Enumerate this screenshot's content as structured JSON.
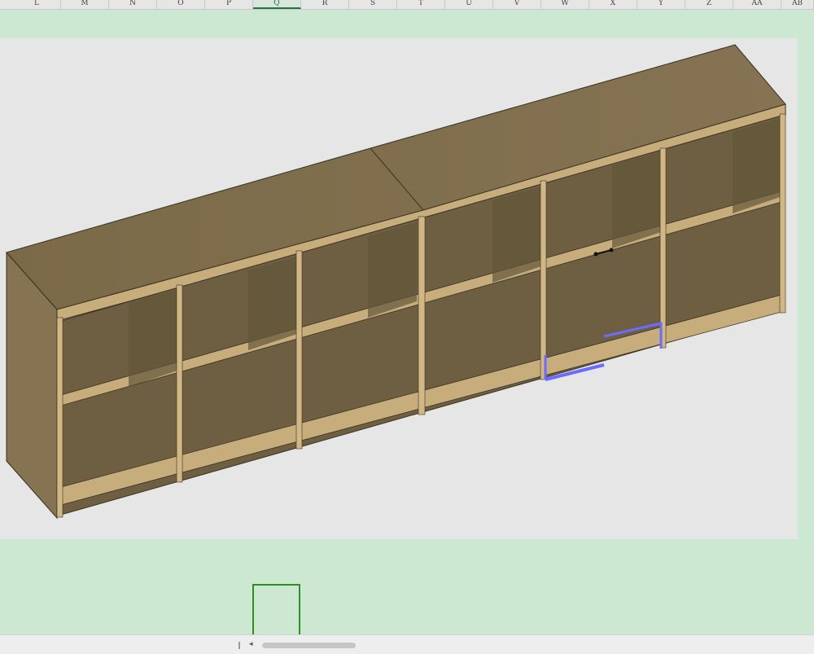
{
  "columns": [
    "L",
    "M",
    "N",
    "O",
    "P",
    "Q",
    "R",
    "S",
    "T",
    "U",
    "V",
    "W",
    "X",
    "Y",
    "Z",
    "AA",
    "AB"
  ],
  "active_column": "Q",
  "picture": {
    "subject": "3D render of a modular wooden cubby shelving unit"
  },
  "colors": {
    "sheet_background": "#cde8d2",
    "accent": "#217346",
    "selection": "#2f8f1f"
  },
  "scrollbar": {
    "left_arrow": "◂"
  }
}
